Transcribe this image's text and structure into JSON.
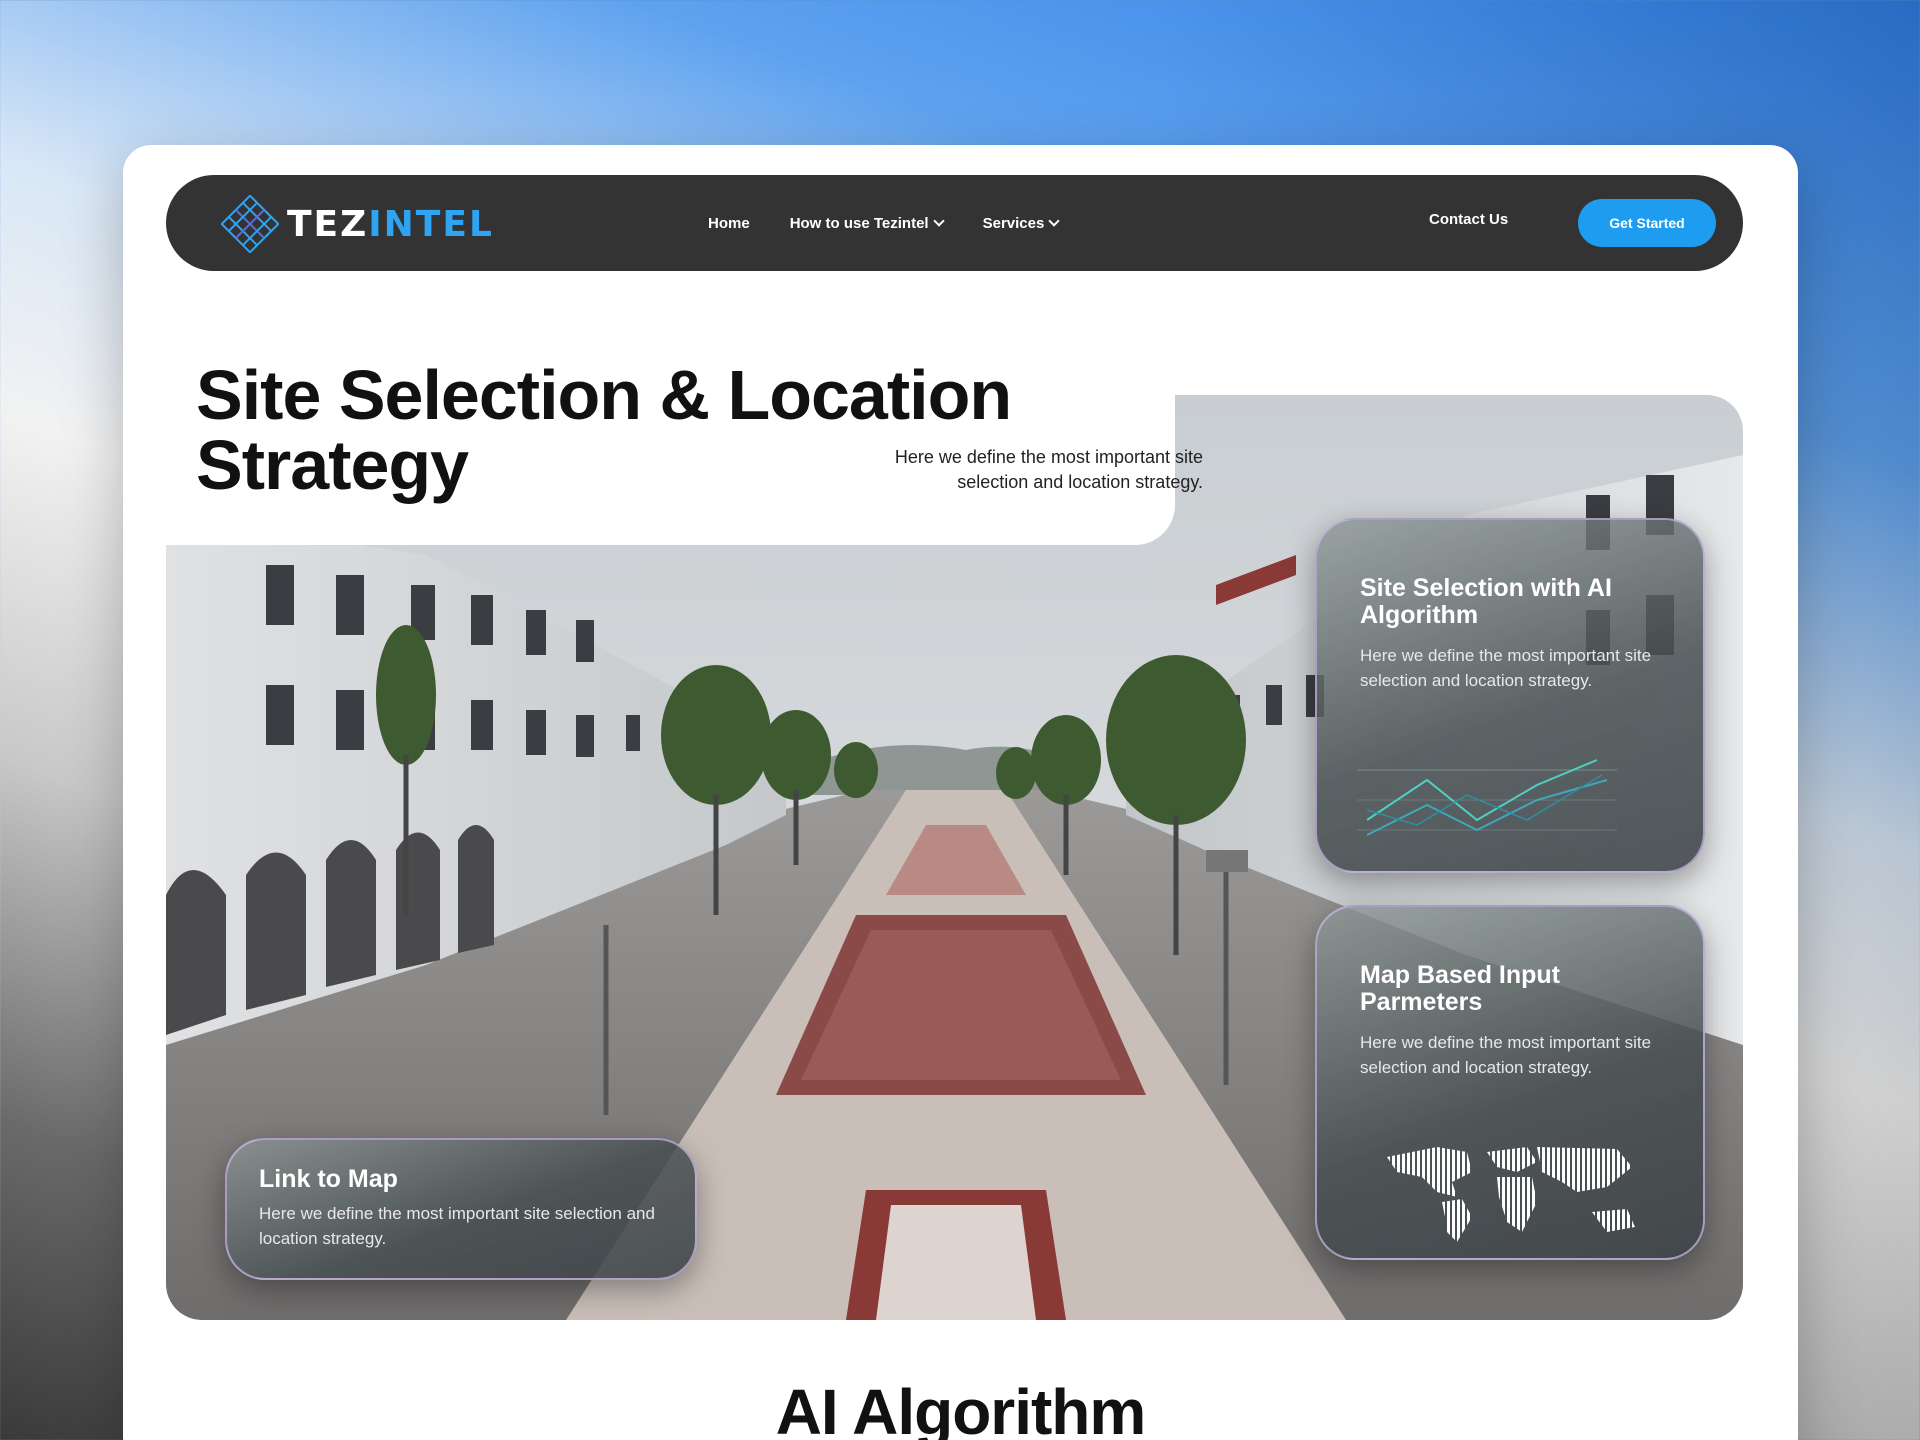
{
  "nav": {
    "logo_text_a": "TEZ",
    "logo_text_b": "INTEL",
    "links": [
      "Home",
      "How to use Tezintel",
      "Services"
    ],
    "contact": "Contact Us",
    "cta": "Get Started"
  },
  "hero": {
    "title_line1": "Site Selection & Location",
    "title_line2": "Strategy",
    "subtitle_line1": "Here we define the most important site",
    "subtitle_line2": "selection and location strategy."
  },
  "cards": {
    "ai": {
      "title_line1": "Site Selection with AI",
      "title_line2": "Algorithm",
      "body": "Here we define the most important site selection and location strategy."
    },
    "map_input": {
      "title_line1": "Map Based Input",
      "title_line2": "Parmeters",
      "body": "Here we define the most important site selection and location strategy."
    },
    "link_map": {
      "title": "Link to Map",
      "body": "Here we define the most important site selection and location strategy."
    }
  },
  "section": {
    "title": "AI Algorithm"
  },
  "colors": {
    "nav_bg": "#333333",
    "accent": "#1e9cf0",
    "logo_accent": "#2fa4f2"
  }
}
